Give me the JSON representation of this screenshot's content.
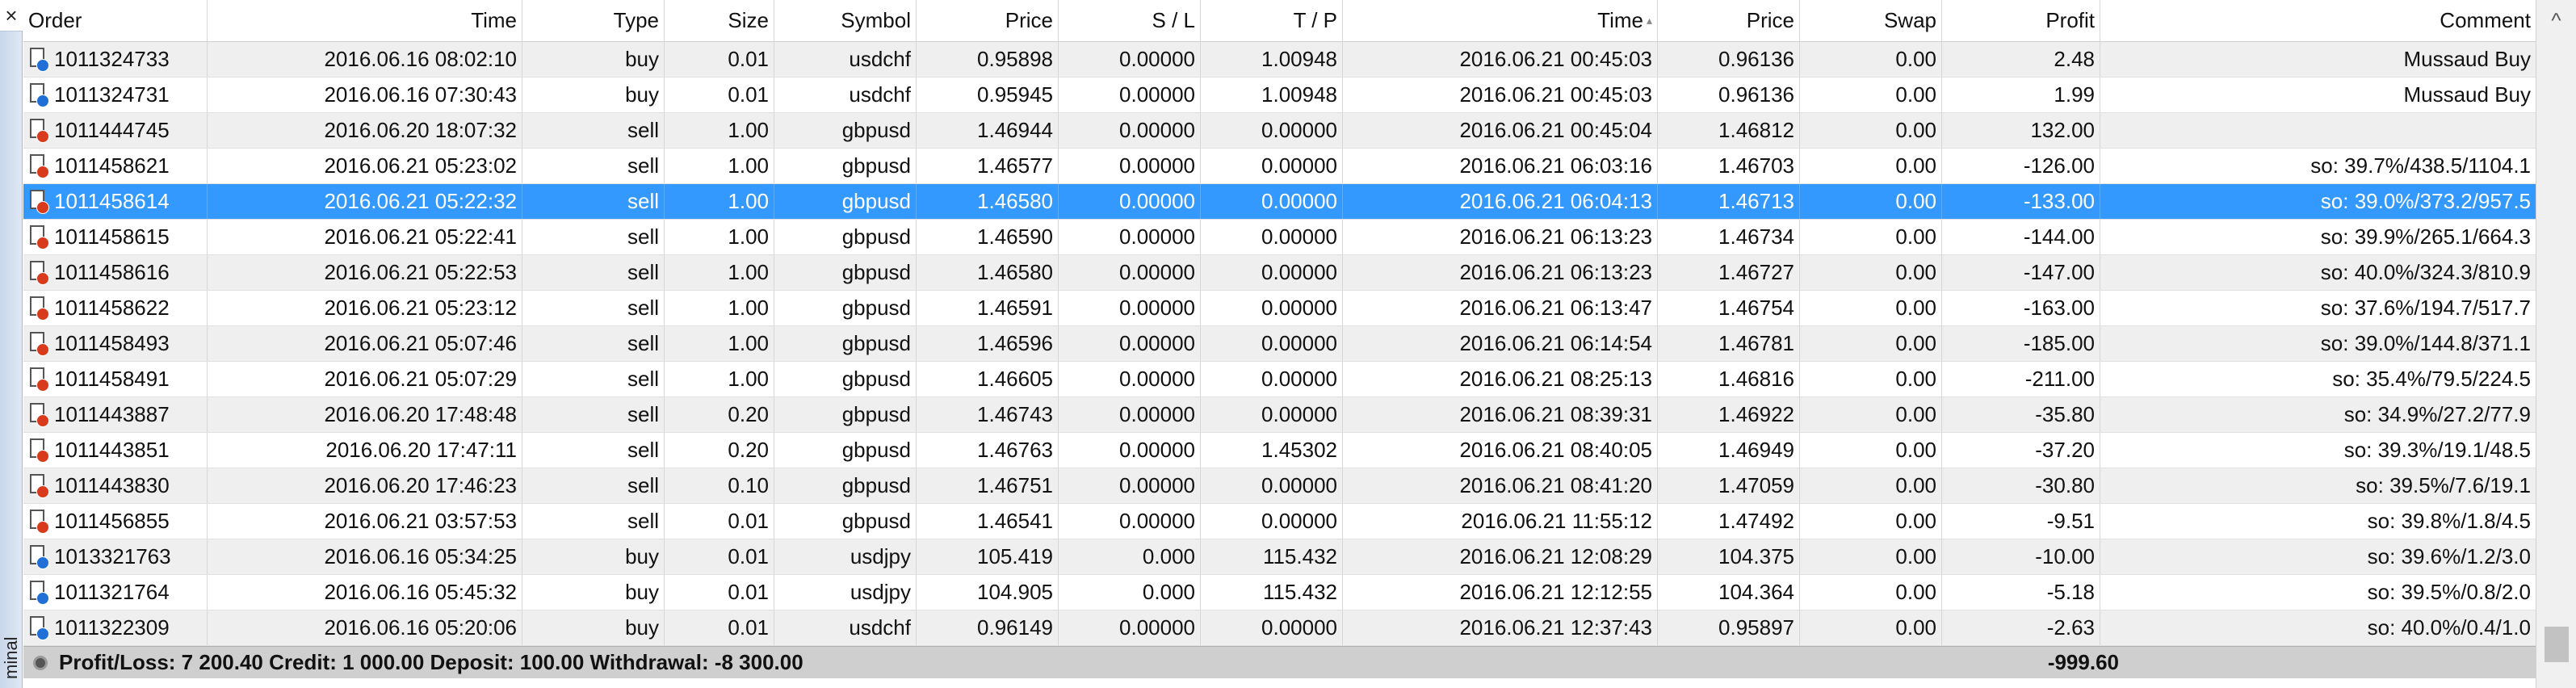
{
  "sidebar": {
    "close_glyph": "×",
    "label": "minal"
  },
  "columns": [
    "Order",
    "Time",
    "Type",
    "Size",
    "Symbol",
    "Price",
    "S / L",
    "T / P",
    "Time",
    "Price",
    "Swap",
    "Profit",
    "Comment"
  ],
  "rows": [
    {
      "order": "1011324733",
      "time": "2016.06.16 08:02:10",
      "type": "buy",
      "size": "0.01",
      "symbol": "usdchf",
      "price": "0.95898",
      "sl": "0.00000",
      "tp": "1.00948",
      "ctime": "2016.06.21 00:45:03",
      "cprice": "0.96136",
      "swap": "0.00",
      "profit": "2.48",
      "comment": "Mussaud Buy"
    },
    {
      "order": "1011324731",
      "time": "2016.06.16 07:30:43",
      "type": "buy",
      "size": "0.01",
      "symbol": "usdchf",
      "price": "0.95945",
      "sl": "0.00000",
      "tp": "1.00948",
      "ctime": "2016.06.21 00:45:03",
      "cprice": "0.96136",
      "swap": "0.00",
      "profit": "1.99",
      "comment": "Mussaud Buy"
    },
    {
      "order": "1011444745",
      "time": "2016.06.20 18:07:32",
      "type": "sell",
      "size": "1.00",
      "symbol": "gbpusd",
      "price": "1.46944",
      "sl": "0.00000",
      "tp": "0.00000",
      "ctime": "2016.06.21 00:45:04",
      "cprice": "1.46812",
      "swap": "0.00",
      "profit": "132.00",
      "comment": ""
    },
    {
      "order": "1011458621",
      "time": "2016.06.21 05:23:02",
      "type": "sell",
      "size": "1.00",
      "symbol": "gbpusd",
      "price": "1.46577",
      "sl": "0.00000",
      "tp": "0.00000",
      "ctime": "2016.06.21 06:03:16",
      "cprice": "1.46703",
      "swap": "0.00",
      "profit": "-126.00",
      "comment": "so: 39.7%/438.5/1104.1"
    },
    {
      "order": "1011458614",
      "time": "2016.06.21 05:22:32",
      "type": "sell",
      "size": "1.00",
      "symbol": "gbpusd",
      "price": "1.46580",
      "sl": "0.00000",
      "tp": "0.00000",
      "ctime": "2016.06.21 06:04:13",
      "cprice": "1.46713",
      "swap": "0.00",
      "profit": "-133.00",
      "comment": "so: 39.0%/373.2/957.5",
      "selected": true
    },
    {
      "order": "1011458615",
      "time": "2016.06.21 05:22:41",
      "type": "sell",
      "size": "1.00",
      "symbol": "gbpusd",
      "price": "1.46590",
      "sl": "0.00000",
      "tp": "0.00000",
      "ctime": "2016.06.21 06:13:23",
      "cprice": "1.46734",
      "swap": "0.00",
      "profit": "-144.00",
      "comment": "so: 39.9%/265.1/664.3"
    },
    {
      "order": "1011458616",
      "time": "2016.06.21 05:22:53",
      "type": "sell",
      "size": "1.00",
      "symbol": "gbpusd",
      "price": "1.46580",
      "sl": "0.00000",
      "tp": "0.00000",
      "ctime": "2016.06.21 06:13:23",
      "cprice": "1.46727",
      "swap": "0.00",
      "profit": "-147.00",
      "comment": "so: 40.0%/324.3/810.9"
    },
    {
      "order": "1011458622",
      "time": "2016.06.21 05:23:12",
      "type": "sell",
      "size": "1.00",
      "symbol": "gbpusd",
      "price": "1.46591",
      "sl": "0.00000",
      "tp": "0.00000",
      "ctime": "2016.06.21 06:13:47",
      "cprice": "1.46754",
      "swap": "0.00",
      "profit": "-163.00",
      "comment": "so: 37.6%/194.7/517.7"
    },
    {
      "order": "1011458493",
      "time": "2016.06.21 05:07:46",
      "type": "sell",
      "size": "1.00",
      "symbol": "gbpusd",
      "price": "1.46596",
      "sl": "0.00000",
      "tp": "0.00000",
      "ctime": "2016.06.21 06:14:54",
      "cprice": "1.46781",
      "swap": "0.00",
      "profit": "-185.00",
      "comment": "so: 39.0%/144.8/371.1"
    },
    {
      "order": "1011458491",
      "time": "2016.06.21 05:07:29",
      "type": "sell",
      "size": "1.00",
      "symbol": "gbpusd",
      "price": "1.46605",
      "sl": "0.00000",
      "tp": "0.00000",
      "ctime": "2016.06.21 08:25:13",
      "cprice": "1.46816",
      "swap": "0.00",
      "profit": "-211.00",
      "comment": "so: 35.4%/79.5/224.5"
    },
    {
      "order": "1011443887",
      "time": "2016.06.20 17:48:48",
      "type": "sell",
      "size": "0.20",
      "symbol": "gbpusd",
      "price": "1.46743",
      "sl": "0.00000",
      "tp": "0.00000",
      "ctime": "2016.06.21 08:39:31",
      "cprice": "1.46922",
      "swap": "0.00",
      "profit": "-35.80",
      "comment": "so: 34.9%/27.2/77.9"
    },
    {
      "order": "1011443851",
      "time": "2016.06.20 17:47:11",
      "type": "sell",
      "size": "0.20",
      "symbol": "gbpusd",
      "price": "1.46763",
      "sl": "0.00000",
      "tp": "1.45302",
      "ctime": "2016.06.21 08:40:05",
      "cprice": "1.46949",
      "swap": "0.00",
      "profit": "-37.20",
      "comment": "so: 39.3%/19.1/48.5"
    },
    {
      "order": "1011443830",
      "time": "2016.06.20 17:46:23",
      "type": "sell",
      "size": "0.10",
      "symbol": "gbpusd",
      "price": "1.46751",
      "sl": "0.00000",
      "tp": "0.00000",
      "ctime": "2016.06.21 08:41:20",
      "cprice": "1.47059",
      "swap": "0.00",
      "profit": "-30.80",
      "comment": "so: 39.5%/7.6/19.1"
    },
    {
      "order": "1011456855",
      "time": "2016.06.21 03:57:53",
      "type": "sell",
      "size": "0.01",
      "symbol": "gbpusd",
      "price": "1.46541",
      "sl": "0.00000",
      "tp": "0.00000",
      "ctime": "2016.06.21 11:55:12",
      "cprice": "1.47492",
      "swap": "0.00",
      "profit": "-9.51",
      "comment": "so: 39.8%/1.8/4.5"
    },
    {
      "order": "1013321763",
      "time": "2016.06.16 05:34:25",
      "type": "buy",
      "size": "0.01",
      "symbol": "usdjpy",
      "price": "105.419",
      "sl": "0.000",
      "tp": "115.432",
      "ctime": "2016.06.21 12:08:29",
      "cprice": "104.375",
      "swap": "0.00",
      "profit": "-10.00",
      "comment": "so: 39.6%/1.2/3.0"
    },
    {
      "order": "1011321764",
      "time": "2016.06.16 05:45:32",
      "type": "buy",
      "size": "0.01",
      "symbol": "usdjpy",
      "price": "104.905",
      "sl": "0.000",
      "tp": "115.432",
      "ctime": "2016.06.21 12:12:55",
      "cprice": "104.364",
      "swap": "0.00",
      "profit": "-5.18",
      "comment": "so: 39.5%/0.8/2.0"
    },
    {
      "order": "1011322309",
      "time": "2016.06.16 05:20:06",
      "type": "buy",
      "size": "0.01",
      "symbol": "usdchf",
      "price": "0.96149",
      "sl": "0.00000",
      "tp": "0.00000",
      "ctime": "2016.06.21 12:37:43",
      "cprice": "0.95897",
      "swap": "0.00",
      "profit": "-2.63",
      "comment": "so: 40.0%/0.4/1.0"
    }
  ],
  "summary": {
    "text": "Profit/Loss: 7 200.40   Credit: 1 000.00   Deposit: 100.00   Withdrawal: -8 300.00",
    "total_profit": "-999.60"
  },
  "scrollbar": {
    "up_glyph": "^"
  },
  "colors": {
    "selected_row": "#3399ff",
    "alt_row": "#efefef",
    "summary_bar": "#cfcfcf",
    "buy_dot": "#1f6fd6",
    "sell_dot": "#d83a1c"
  }
}
